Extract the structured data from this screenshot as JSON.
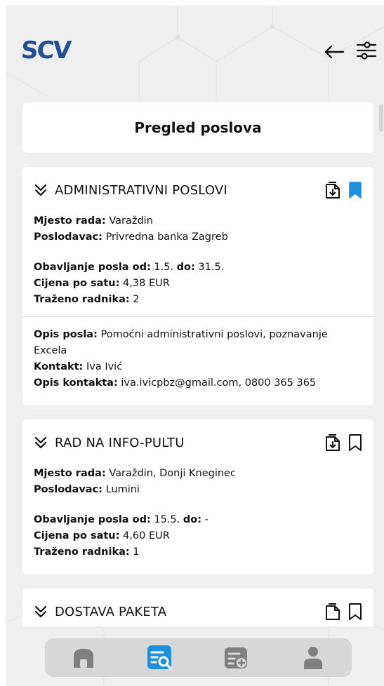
{
  "app": {
    "logo": "SCV",
    "page_title": "Pregled poslova"
  },
  "colors": {
    "accent": "#1f8fe0",
    "logo": "#1f4e9a",
    "icon_gray": "#7f7f7f"
  },
  "header": {
    "back_icon": "arrow-left-icon",
    "filter_icon": "sliders-icon"
  },
  "labels": {
    "location": "Mjesto rada:",
    "employer": "Poslodavac:",
    "period_from": "Obavljanje posla od:",
    "period_to": "do:",
    "hourly": "Cijena po satu:",
    "workers": "Traženo radnika:",
    "description": "Opis posla:",
    "contact": "Kontakt:",
    "contact_info": "Opis kontakta:"
  },
  "jobs": [
    {
      "title": "ADMINISTRATIVNI POSLOVI",
      "bookmarked": true,
      "location": "Varaždin",
      "employer": "Privredna banka Zagreb",
      "from": "1.5.",
      "to": "31.5.",
      "hourly": "4,38 EUR",
      "workers": "2",
      "description": "Pomoćni administrativni poslovi, poznavanje Excela",
      "contact": "Iva Ivić",
      "contact_info": "iva.ivicpbz@gmail.com, 0800 365 365"
    },
    {
      "title": "RAD NA INFO-PULTU",
      "bookmarked": false,
      "location": "Varaždin, Donji Kneginec",
      "employer": "Lumini",
      "from": "15.5.",
      "to": "-",
      "hourly": "4,60 EUR",
      "workers": "1"
    },
    {
      "title": "DOSTAVA PAKETA",
      "bookmarked": false
    }
  ],
  "tabbar": {
    "items": [
      {
        "icon": "home-icon",
        "active": false
      },
      {
        "icon": "job-search-icon",
        "active": true
      },
      {
        "icon": "add-job-icon",
        "active": false
      },
      {
        "icon": "profile-icon",
        "active": false
      }
    ]
  }
}
